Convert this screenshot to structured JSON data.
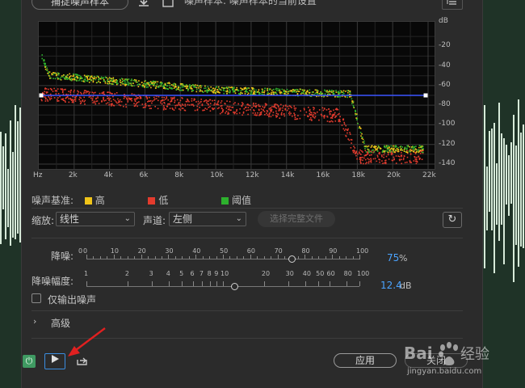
{
  "toolbar": {
    "capture_label": "捕捉噪声样本",
    "sample_text": "噪声样本: 噪声样本的当前设置",
    "save_icon": "download-icon",
    "load_icon": "load-icon",
    "menu_icon": "menu-icon"
  },
  "graph": {
    "db_ticks": [
      "dB",
      "-20",
      "-40",
      "-60",
      "-80",
      "-100",
      "-120",
      "-140"
    ],
    "hz_ticks": [
      "Hz",
      "2k",
      "4k",
      "6k",
      "8k",
      "10k",
      "12k",
      "14k",
      "16k",
      "18k",
      "20k",
      "22k"
    ],
    "threshold_db": -70
  },
  "legend": {
    "title": "噪声基准:",
    "items": [
      {
        "label": "高",
        "color": "#f0c419"
      },
      {
        "label": "低",
        "color": "#e33b2d"
      },
      {
        "label": "阈值",
        "color": "#2db12d"
      }
    ]
  },
  "controls": {
    "zoom_label": "缩放:",
    "zoom_value": "线性",
    "channel_label": "声道:",
    "channel_value": "左侧",
    "select_file_label": "选择完整文件"
  },
  "reduction": {
    "label": "降噪:",
    "ticks": [
      "0",
      "0",
      "10",
      "20",
      "30",
      "40",
      "50",
      "60",
      "70",
      "80",
      "90",
      "100"
    ],
    "value": "75",
    "unit": "%",
    "percent": 75
  },
  "amount": {
    "label": "降噪幅度:",
    "ticks": [
      "1",
      "2",
      "3",
      "4",
      "5",
      "6",
      "7",
      "8",
      "9",
      "10",
      "20",
      "30",
      "40",
      "50",
      "60",
      "80",
      "100"
    ],
    "value": "12.4",
    "unit": "dB"
  },
  "output_noise_label": "仅输出噪声",
  "advanced_label": "高级",
  "bottom": {
    "apply_label": "应用",
    "close_label": "关闭"
  },
  "watermark": {
    "brand": "Baidu经验",
    "url": "jingyan.baidu.com"
  },
  "colors": {
    "accent": "#4aa3ff",
    "threshold_line": "#3b55ff",
    "high": "#f0c419",
    "low": "#e33b2d",
    "threshold": "#2db12d"
  }
}
